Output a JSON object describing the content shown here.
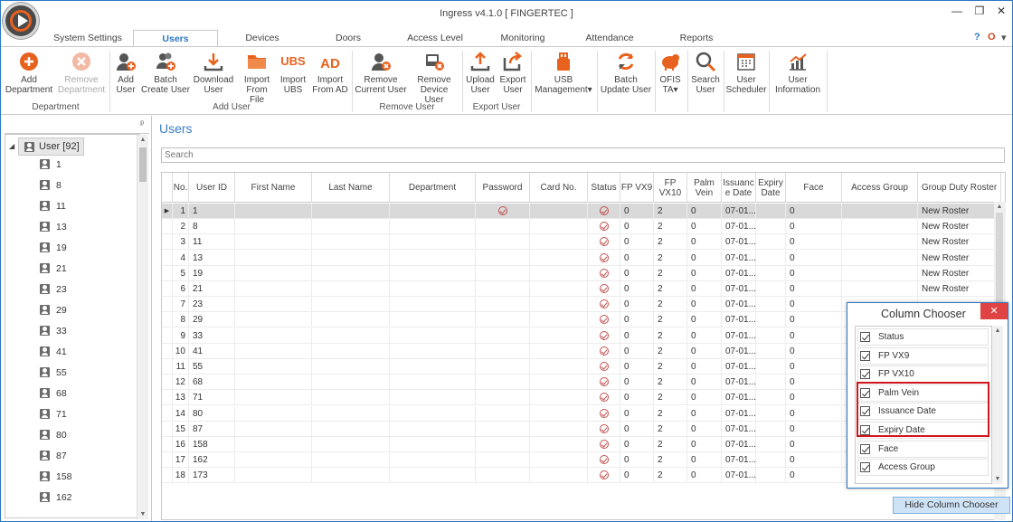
{
  "app": {
    "title": "Ingress v4.1.0 [ FINGERTEC ]",
    "window_controls": {
      "minimize": "—",
      "restore": "❐",
      "close": "✕"
    }
  },
  "tabs": [
    {
      "label": "System Settings"
    },
    {
      "label": "Users"
    },
    {
      "label": "Devices"
    },
    {
      "label": "Doors"
    },
    {
      "label": "Access Level"
    },
    {
      "label": "Monitoring"
    },
    {
      "label": "Attendance"
    },
    {
      "label": "Reports"
    }
  ],
  "tab_icons": {
    "help": "?",
    "office": "O",
    "settings": "▾"
  },
  "ribbon": {
    "buttons": [
      {
        "label": "Add\nDepartment"
      },
      {
        "label": "Remove\nDepartment"
      },
      {
        "label": "Add\nUser"
      },
      {
        "label": "Batch\nCreate User"
      },
      {
        "label": "Download\nUser"
      },
      {
        "label": "Import\nFrom File"
      },
      {
        "label": "Import\nUBS",
        "icon_text": "UBS"
      },
      {
        "label": "Import\nFrom AD",
        "icon_text": "AD"
      },
      {
        "label": "Remove\nCurrent User"
      },
      {
        "label": "Remove\nDevice User"
      },
      {
        "label": "Upload\nUser"
      },
      {
        "label": "Export\nUser"
      },
      {
        "label": "USB\nManagement▾"
      },
      {
        "label": "Batch\nUpdate User"
      },
      {
        "label": "OFIS\nTA▾"
      },
      {
        "label": "Search\nUser"
      },
      {
        "label": "User\nScheduler"
      },
      {
        "label": "User\nInformation"
      }
    ],
    "groups": [
      {
        "label": "Department"
      },
      {
        "label": "Add User"
      },
      {
        "label": "Remove User"
      },
      {
        "label": "Export User"
      }
    ]
  },
  "left_panel": {
    "pin": "ᵖ",
    "root_label": "User [92]",
    "items": [
      "1",
      "8",
      "11",
      "13",
      "19",
      "21",
      "23",
      "29",
      "33",
      "41",
      "55",
      "68",
      "71",
      "80",
      "87",
      "158",
      "162"
    ]
  },
  "main": {
    "title": "Users",
    "search_placeholder": "Search",
    "columns": [
      "No.",
      "User ID",
      "First Name",
      "Last Name",
      "Department",
      "Password",
      "Card No.",
      "Status",
      "FP VX9",
      "FP VX10",
      "Palm Vein",
      "Issuanc e Date",
      "Expiry Date",
      "Face",
      "Access Group",
      "Group Duty Roster"
    ],
    "rows": [
      {
        "no": "1",
        "id": "1",
        "password": true,
        "fp9": "0",
        "fp10": "2",
        "palm": "0",
        "issue": "07-01...",
        "face": "0",
        "roster": "New Roster"
      },
      {
        "no": "2",
        "id": "8",
        "password": false,
        "fp9": "0",
        "fp10": "2",
        "palm": "0",
        "issue": "07-01...",
        "face": "0",
        "roster": "New Roster"
      },
      {
        "no": "3",
        "id": "11",
        "password": false,
        "fp9": "0",
        "fp10": "2",
        "palm": "0",
        "issue": "07-01...",
        "face": "0",
        "roster": "New Roster"
      },
      {
        "no": "4",
        "id": "13",
        "password": false,
        "fp9": "0",
        "fp10": "2",
        "palm": "0",
        "issue": "07-01...",
        "face": "0",
        "roster": "New Roster"
      },
      {
        "no": "5",
        "id": "19",
        "password": false,
        "fp9": "0",
        "fp10": "2",
        "palm": "0",
        "issue": "07-01...",
        "face": "0",
        "roster": "New Roster"
      },
      {
        "no": "6",
        "id": "21",
        "password": false,
        "fp9": "0",
        "fp10": "2",
        "palm": "0",
        "issue": "07-01...",
        "face": "0",
        "roster": "New Roster"
      },
      {
        "no": "7",
        "id": "23",
        "password": false,
        "fp9": "0",
        "fp10": "2",
        "palm": "0",
        "issue": "07-01...",
        "face": "0",
        "roster": ""
      },
      {
        "no": "8",
        "id": "29",
        "password": false,
        "fp9": "0",
        "fp10": "2",
        "palm": "0",
        "issue": "07-01...",
        "face": "0",
        "roster": ""
      },
      {
        "no": "9",
        "id": "33",
        "password": false,
        "fp9": "0",
        "fp10": "2",
        "palm": "0",
        "issue": "07-01...",
        "face": "0",
        "roster": ""
      },
      {
        "no": "10",
        "id": "41",
        "password": false,
        "fp9": "0",
        "fp10": "2",
        "palm": "0",
        "issue": "07-01...",
        "face": "0",
        "roster": ""
      },
      {
        "no": "11",
        "id": "55",
        "password": false,
        "fp9": "0",
        "fp10": "2",
        "palm": "0",
        "issue": "07-01...",
        "face": "0",
        "roster": ""
      },
      {
        "no": "12",
        "id": "68",
        "password": false,
        "fp9": "0",
        "fp10": "2",
        "palm": "0",
        "issue": "07-01...",
        "face": "0",
        "roster": ""
      },
      {
        "no": "13",
        "id": "71",
        "password": false,
        "fp9": "0",
        "fp10": "2",
        "palm": "0",
        "issue": "07-01...",
        "face": "0",
        "roster": ""
      },
      {
        "no": "14",
        "id": "80",
        "password": false,
        "fp9": "0",
        "fp10": "2",
        "palm": "0",
        "issue": "07-01...",
        "face": "0",
        "roster": ""
      },
      {
        "no": "15",
        "id": "87",
        "password": false,
        "fp9": "0",
        "fp10": "2",
        "palm": "0",
        "issue": "07-01...",
        "face": "0",
        "roster": ""
      },
      {
        "no": "16",
        "id": "158",
        "password": false,
        "fp9": "0",
        "fp10": "2",
        "palm": "0",
        "issue": "07-01...",
        "face": "0",
        "roster": ""
      },
      {
        "no": "17",
        "id": "162",
        "password": false,
        "fp9": "0",
        "fp10": "2",
        "palm": "0",
        "issue": "07-01...",
        "face": "0",
        "roster": ""
      },
      {
        "no": "18",
        "id": "173",
        "password": false,
        "fp9": "0",
        "fp10": "2",
        "palm": "0",
        "issue": "07-01...",
        "face": "0",
        "roster": ""
      }
    ]
  },
  "column_chooser": {
    "title": "Column Chooser",
    "close": "✕",
    "items": [
      "Status",
      "FP VX9",
      "FP VX10",
      "Palm Vein",
      "Issuance Date",
      "Expiry Date",
      "Face",
      "Access Group"
    ],
    "hide_button": "Hide Column Chooser"
  },
  "colors": {
    "accent": "#2b78c5",
    "close_red": "#e04343",
    "highlight": "#d0161b",
    "orange": "#e8621f"
  }
}
